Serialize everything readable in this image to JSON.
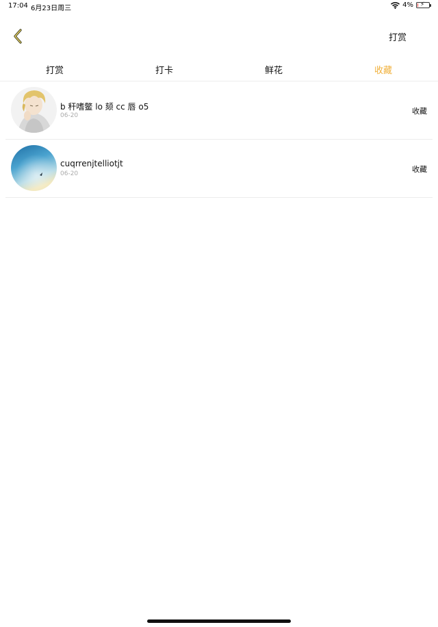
{
  "status_bar": {
    "time": "17:04",
    "date": "6月23日周三",
    "battery": "4%",
    "battery_level": 0.04,
    "wifi_icon": "wifi-icon",
    "battery_icon": "battery-charging-icon"
  },
  "nav": {
    "back_icon": "chevron-left-icon",
    "action_label": "打赏",
    "accent_color": "#f0b03a"
  },
  "tabs": [
    {
      "label": "打赏",
      "active": false
    },
    {
      "label": "打卡",
      "active": false
    },
    {
      "label": "鲜花",
      "active": false
    },
    {
      "label": "收藏",
      "active": true
    }
  ],
  "list": {
    "items": [
      {
        "name": "b 秆嗜鳖 lo 颏 cc 唇 o5",
        "date": "06-20",
        "action": "收藏",
        "avatar": "anime-character-avatar"
      },
      {
        "name": "cuqrrenjtelliotjt",
        "date": "06-20",
        "action": "收藏",
        "avatar": "blue-sky-avatar"
      }
    ]
  }
}
